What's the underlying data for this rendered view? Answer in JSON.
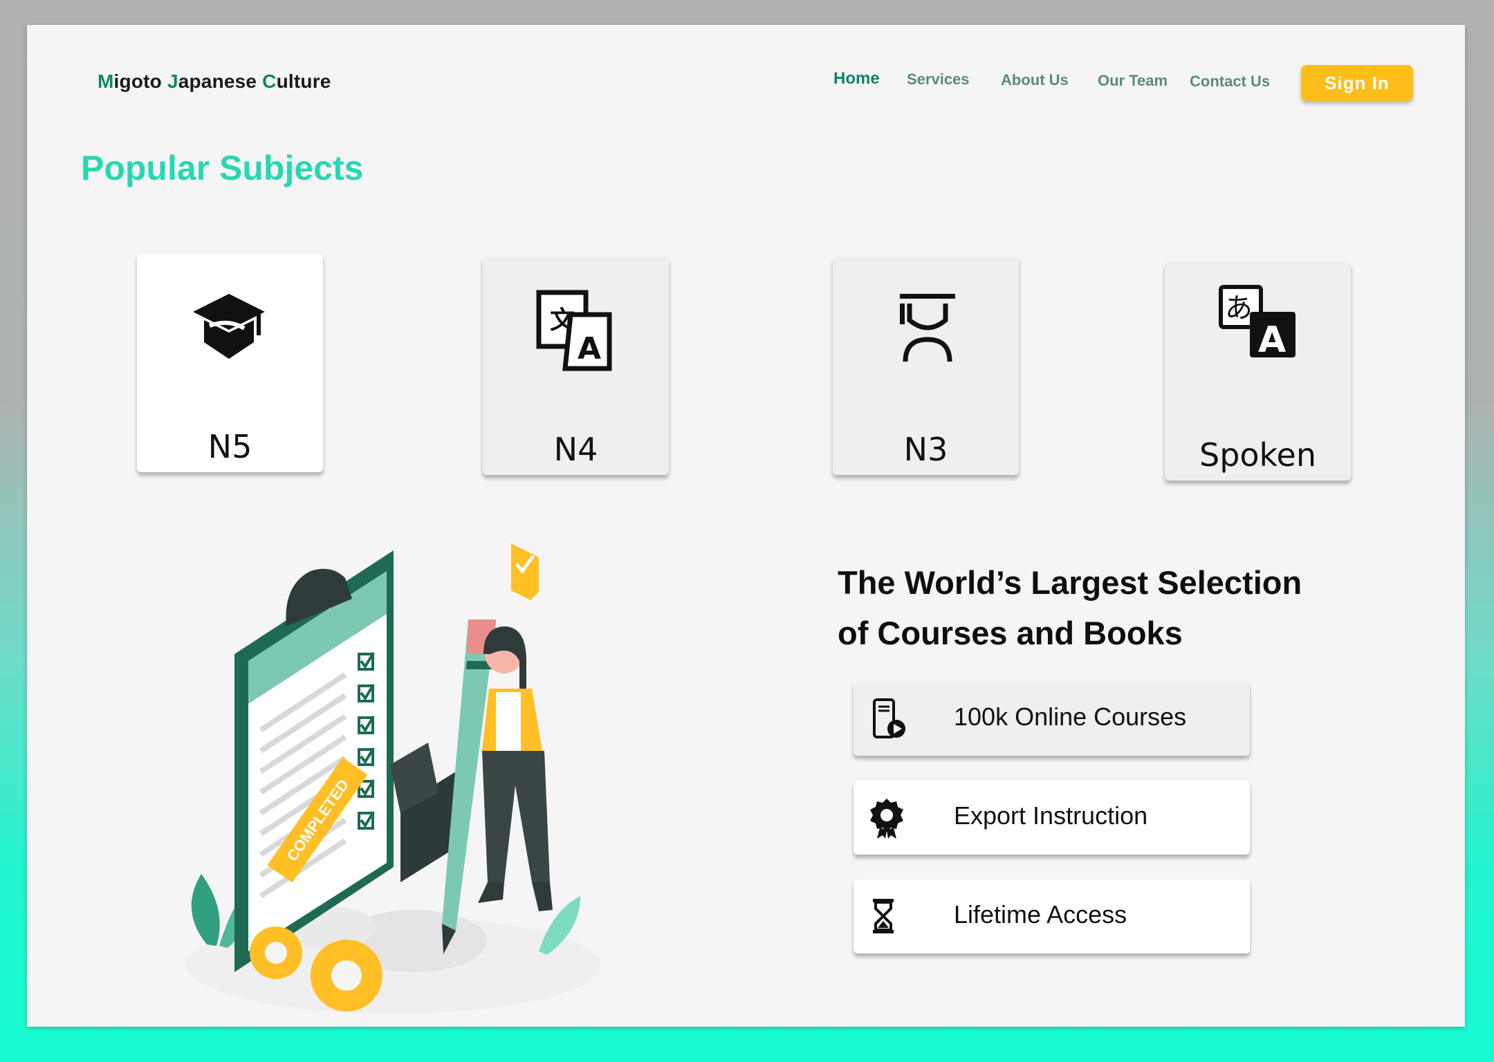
{
  "header": {
    "logo": {
      "M": "M",
      "rest1": "igoto ",
      "J": "J",
      "rest2": "apanese ",
      "C": "C",
      "rest3": "ulture"
    },
    "nav": [
      "Home",
      "Services",
      "About Us",
      "Our Team",
      "Contact Us"
    ],
    "active_nav": "Home",
    "signin_label": "Sign  In"
  },
  "popular": {
    "title": "Popular Subjects",
    "cards": [
      {
        "label": "N5",
        "icon": "graduation-cap-icon"
      },
      {
        "label": "N4",
        "icon": "translate-icon"
      },
      {
        "label": "N3",
        "icon": "student-icon"
      },
      {
        "label": "Spoken",
        "icon": "language-icon"
      }
    ]
  },
  "illustration": {
    "badge_text": "COMPLETED"
  },
  "promo": {
    "headline": "The World’s  Largest Selection\nof Courses and Books",
    "features": [
      {
        "label": "100k Online Courses",
        "icon": "mobile-video-icon"
      },
      {
        "label": "Export Instruction",
        "icon": "award-icon"
      },
      {
        "label": "Lifetime Access",
        "icon": "hourglass-icon"
      }
    ]
  },
  "colors": {
    "accent": "#27d7b2",
    "nav_active": "#0e8566",
    "button": "#ffbd1b",
    "logo_initial": "#10895f"
  }
}
